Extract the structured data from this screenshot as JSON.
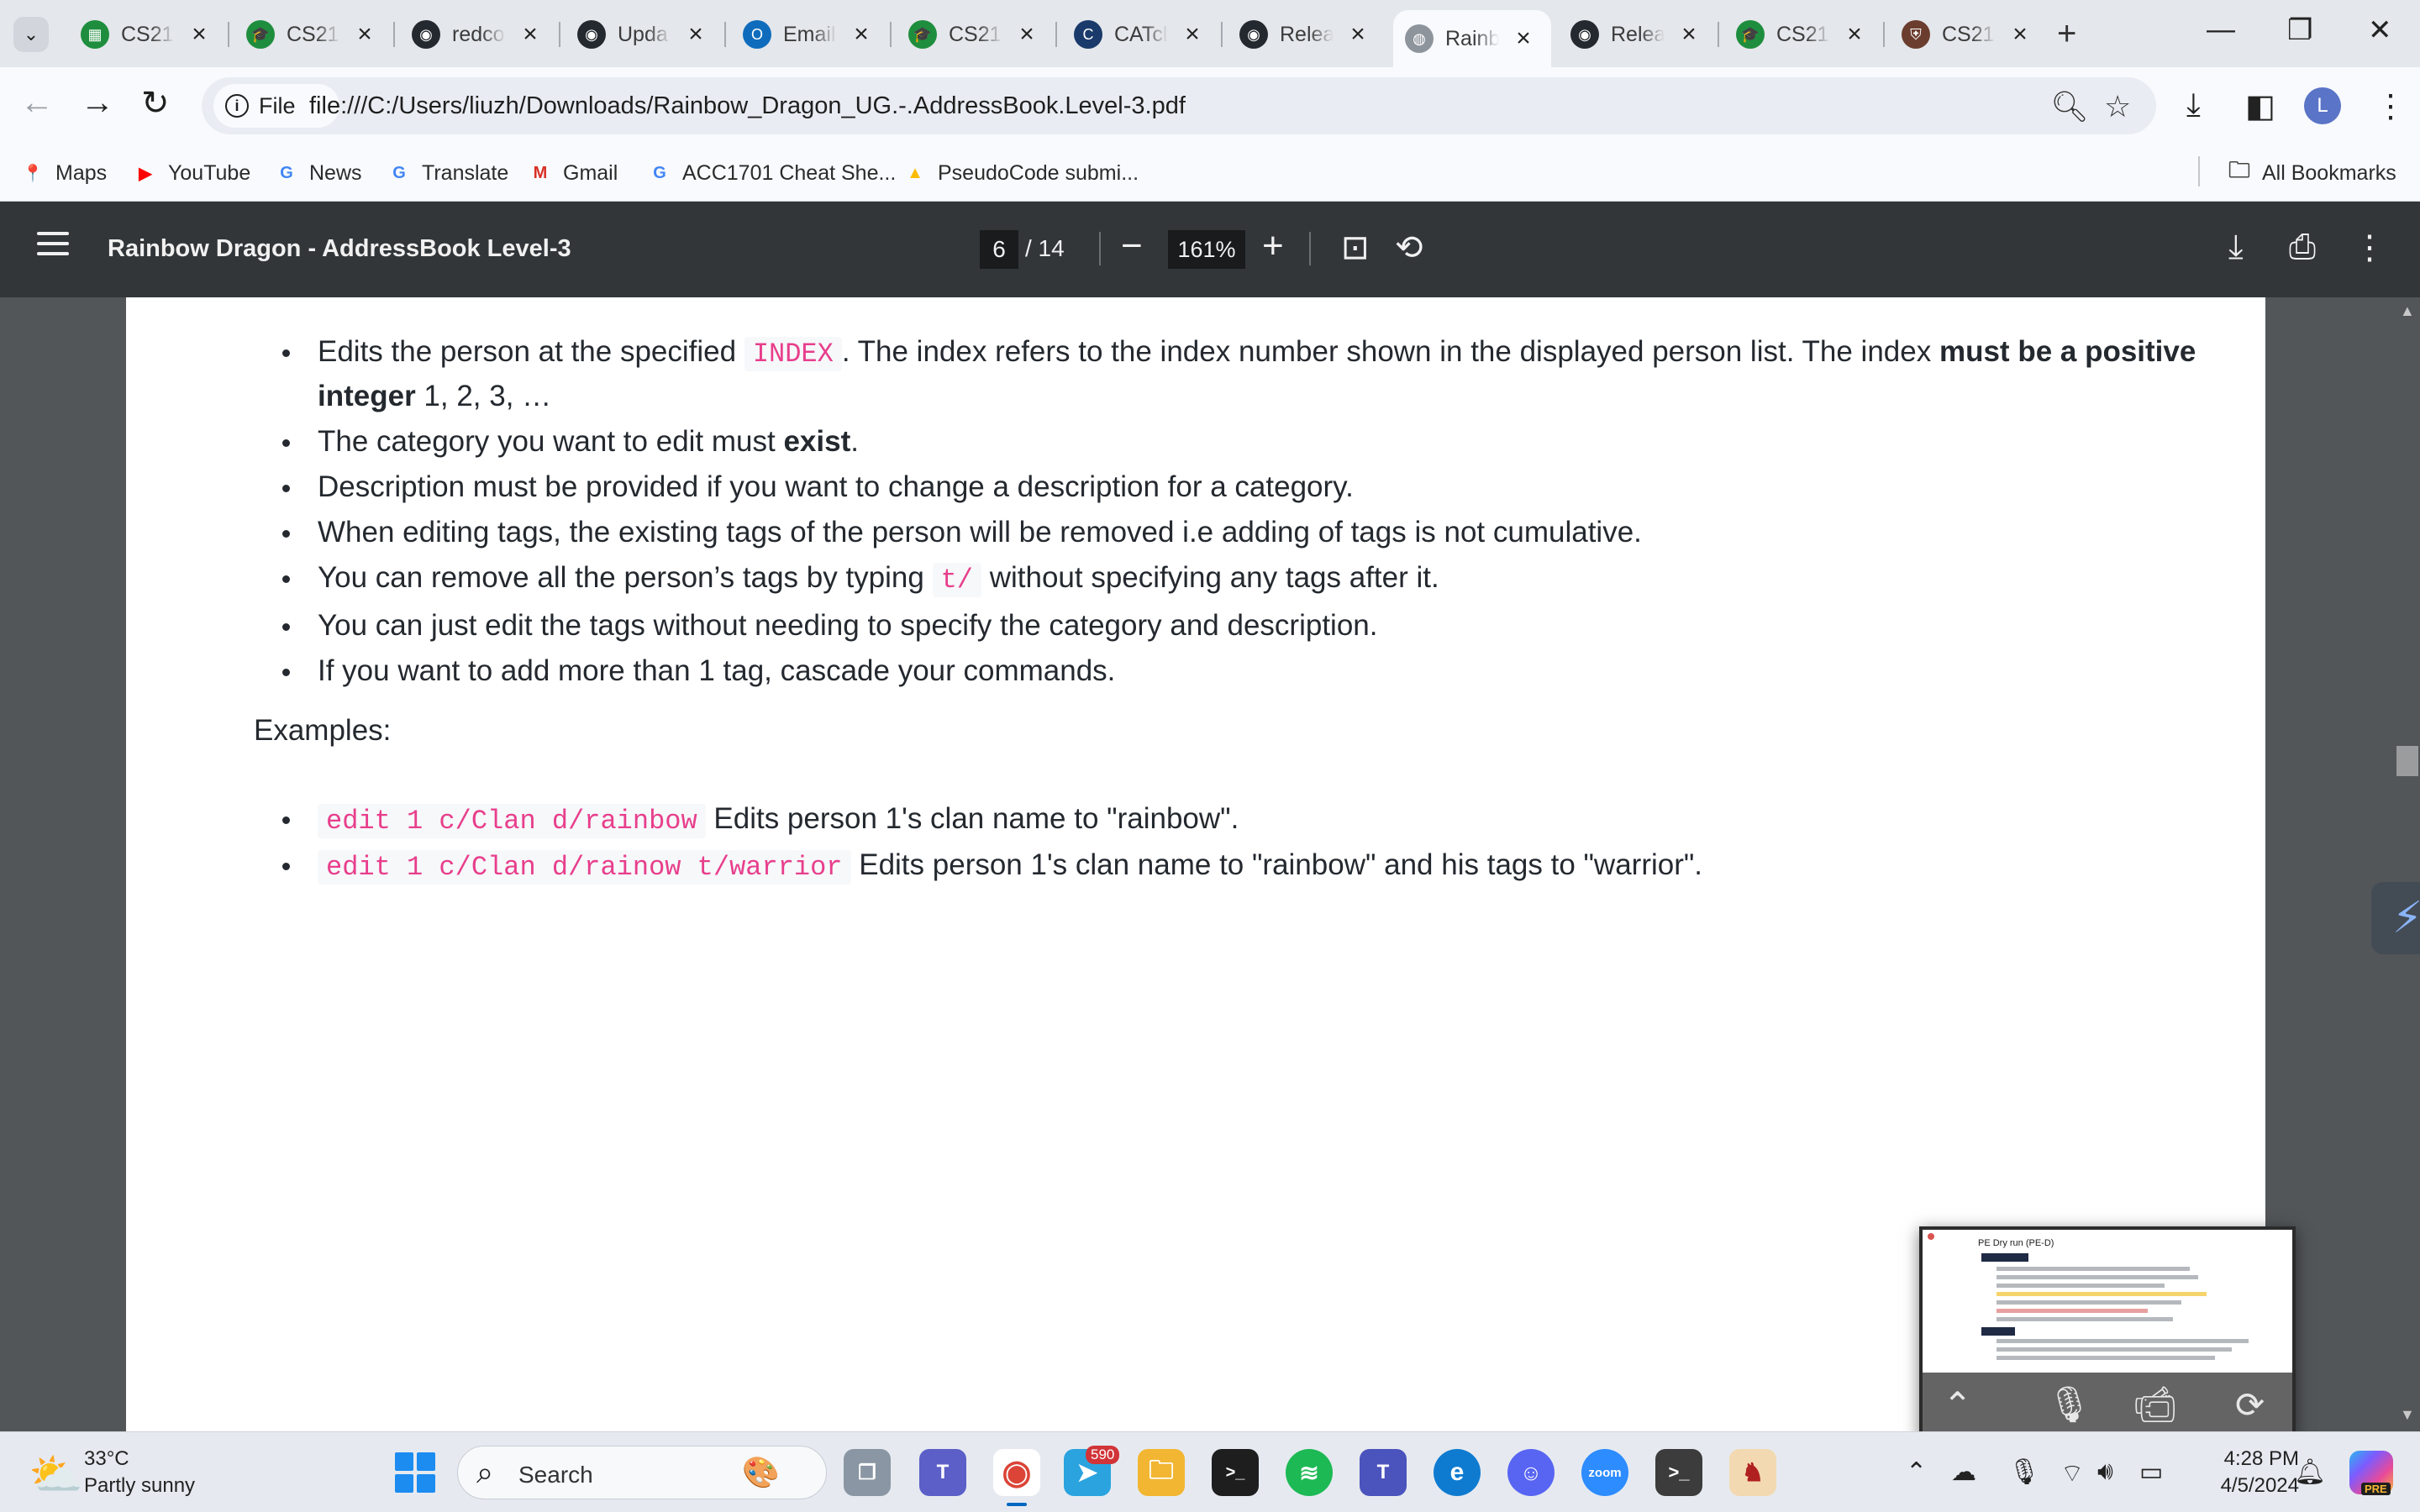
{
  "browser": {
    "tabs": [
      {
        "title": "CS21",
        "icon_color": "#1e8e3e",
        "icon": "spreadsheet-icon",
        "glyph": "▦",
        "active": false
      },
      {
        "title": "CS21",
        "icon_color": "#1e8e3e",
        "icon": "graduation-cap-icon",
        "glyph": "🎓",
        "active": false
      },
      {
        "title": "redco",
        "icon_color": "#24292f",
        "icon": "github-icon",
        "glyph": "◉",
        "active": false
      },
      {
        "title": "Upda",
        "icon_color": "#24292f",
        "icon": "github-icon",
        "glyph": "◉",
        "active": false
      },
      {
        "title": "Email",
        "icon_color": "#0f6cbd",
        "icon": "outlook-icon",
        "glyph": "O",
        "active": false
      },
      {
        "title": "CS21",
        "icon_color": "#1e8e3e",
        "icon": "graduation-cap-icon",
        "glyph": "🎓",
        "active": false
      },
      {
        "title": "CATcl",
        "icon_color": "#1a3a6b",
        "icon": "catcher-icon",
        "glyph": "C",
        "active": false
      },
      {
        "title": "Relea",
        "icon_color": "#24292f",
        "icon": "github-icon",
        "glyph": "◉",
        "active": false
      },
      {
        "title": "Rainb",
        "icon_color": "#8e949c",
        "icon": "globe-icon",
        "glyph": "◍",
        "active": true
      },
      {
        "title": "Relea",
        "icon_color": "#24292f",
        "icon": "github-icon",
        "glyph": "◉",
        "active": false
      },
      {
        "title": "CS21",
        "icon_color": "#1e8e3e",
        "icon": "graduation-cap-icon",
        "glyph": "🎓",
        "active": false
      },
      {
        "title": "CS21",
        "icon_color": "#6b3d2e",
        "icon": "university-crest-icon",
        "glyph": "⛨",
        "active": false
      }
    ],
    "file_label": "File",
    "url": "file:///C:/Users/liuzh/Downloads/Rainbow_Dragon_UG.-.AddressBook.Level-3.pdf",
    "profile_initial": "L",
    "bookmarks": [
      {
        "label": "Maps",
        "icon": "maps-pin-icon",
        "glyph": "📍",
        "color": "#ea4335"
      },
      {
        "label": "YouTube",
        "icon": "youtube-icon",
        "glyph": "▶",
        "color": "#ff0000"
      },
      {
        "label": "News",
        "icon": "news-icon",
        "glyph": "G",
        "color": "#4285f4"
      },
      {
        "label": "Translate",
        "icon": "translate-icon",
        "glyph": "G",
        "color": "#4285f4"
      },
      {
        "label": "Gmail",
        "icon": "gmail-icon",
        "glyph": "M",
        "color": "#d93025"
      },
      {
        "label": "ACC1701 Cheat She...",
        "icon": "google-icon",
        "glyph": "G",
        "color": "#4285f4"
      },
      {
        "label": "PseudoCode submi...",
        "icon": "drive-icon",
        "glyph": "▲",
        "color": "#fbbc04"
      }
    ],
    "all_bookmarks_label": "All Bookmarks"
  },
  "pdf": {
    "title": "Rainbow Dragon - AddressBook Level-3",
    "current_page": "6",
    "total_pages": "/ 14",
    "zoom": "161%",
    "bullets": [
      {
        "parts": [
          {
            "t": "text",
            "v": "Edits the person at the specified "
          },
          {
            "t": "code",
            "v": "INDEX"
          },
          {
            "t": "text",
            "v": ". The index refers to the index number shown in the displayed person list. The index "
          },
          {
            "t": "bold",
            "v": "must be a positive integer"
          },
          {
            "t": "text",
            "v": " 1, 2, 3, …"
          }
        ]
      },
      {
        "parts": [
          {
            "t": "text",
            "v": "The category you want to edit must "
          },
          {
            "t": "bold",
            "v": "exist"
          },
          {
            "t": "text",
            "v": "."
          }
        ]
      },
      {
        "parts": [
          {
            "t": "text",
            "v": "Description must be provided if you want to change a description for a category."
          }
        ]
      },
      {
        "parts": [
          {
            "t": "text",
            "v": "When editing tags, the existing tags of the person will be removed i.e adding of tags is not cumulative."
          }
        ]
      },
      {
        "parts": [
          {
            "t": "text",
            "v": "You can remove all the person’s tags by typing "
          },
          {
            "t": "code",
            "v": "t/"
          },
          {
            "t": "text",
            "v": " without specifying any tags after it."
          }
        ]
      },
      {
        "parts": [
          {
            "t": "text",
            "v": "You can just edit the tags without needing to specify the category and description."
          }
        ]
      },
      {
        "parts": [
          {
            "t": "text",
            "v": "If you want to add more than 1 tag, cascade your commands."
          }
        ]
      }
    ],
    "examples_heading": "Examples:",
    "examples": [
      {
        "parts": [
          {
            "t": "code",
            "v": "edit 1 c/Clan d/rainbow"
          },
          {
            "t": "text",
            "v": " Edits person 1's clan name to \"rainbow\"."
          }
        ]
      },
      {
        "parts": [
          {
            "t": "code",
            "v": "edit 1 c/Clan d/rainow t/warrior"
          },
          {
            "t": "text",
            "v": " Edits person 1's clan name to \"rainbow\" and his tags to \"warrior\"."
          }
        ]
      }
    ]
  },
  "mini_window": {
    "title": "PE Dry run (PE-D)"
  },
  "taskbar": {
    "weather_temp": "33°C",
    "weather_condition": "Partly sunny",
    "search_placeholder": "Search",
    "telegram_badge": "590",
    "zoom_label": "zoom",
    "time": "4:28 PM",
    "date": "4/5/2024",
    "copilot_badge": "PRE"
  }
}
